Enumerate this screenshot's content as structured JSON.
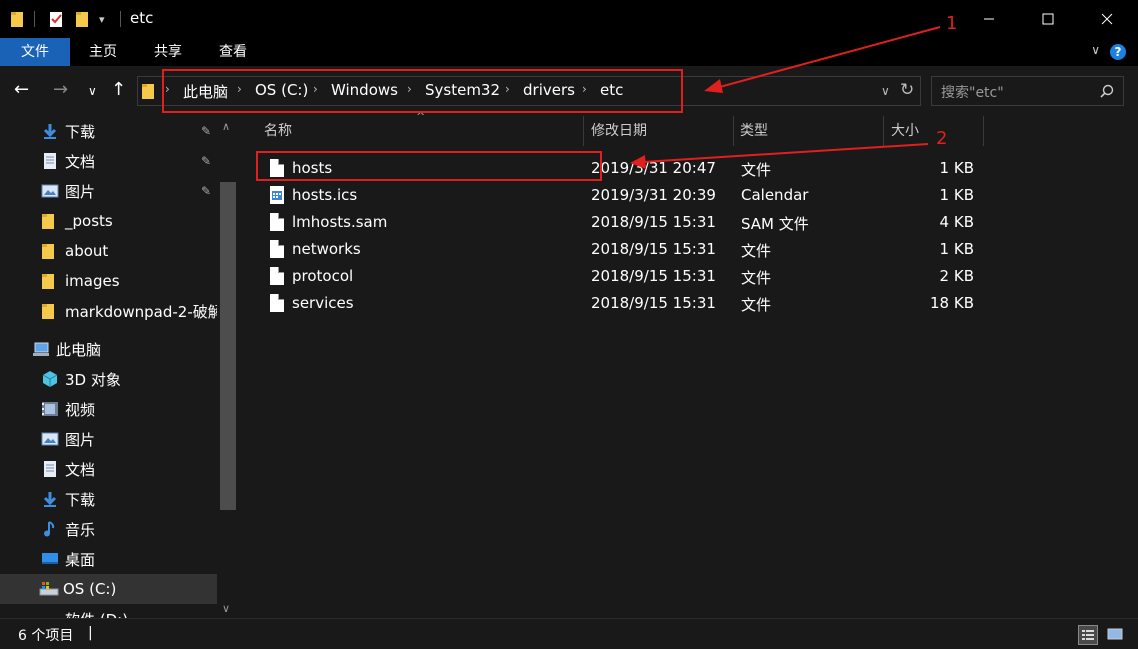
{
  "window": {
    "title": "etc",
    "minimize_icon": "minimize-icon",
    "maximize_icon": "maximize-icon",
    "close_icon": "close-icon"
  },
  "ribbon": {
    "tabs": [
      {
        "label": "文件",
        "active": true
      },
      {
        "label": "主页",
        "active": false
      },
      {
        "label": "共享",
        "active": false
      },
      {
        "label": "查看",
        "active": false
      }
    ],
    "help": "?"
  },
  "address": {
    "crumbs": [
      "此电脑",
      "OS (C:)",
      "Windows",
      "System32",
      "drivers",
      "etc"
    ]
  },
  "search": {
    "placeholder": "搜索\"etc\""
  },
  "sidebar": {
    "quick_access": [
      {
        "label": "下载",
        "icon": "download-icon",
        "pinned": true
      },
      {
        "label": "文档",
        "icon": "documents-icon",
        "pinned": true
      },
      {
        "label": "图片",
        "icon": "pictures-icon",
        "pinned": true
      },
      {
        "label": "_posts",
        "icon": "folder-icon",
        "pinned": false
      },
      {
        "label": "about",
        "icon": "folder-icon",
        "pinned": false
      },
      {
        "label": "images",
        "icon": "folder-icon",
        "pinned": false
      },
      {
        "label": "markdownpad-2-破解",
        "icon": "folder-icon",
        "pinned": false
      }
    ],
    "this_pc": {
      "label": "此电脑",
      "icon": "computer-icon"
    },
    "pc_items": [
      {
        "label": "3D 对象",
        "icon": "3d-objects-icon"
      },
      {
        "label": "视频",
        "icon": "videos-icon"
      },
      {
        "label": "图片",
        "icon": "pictures-icon"
      },
      {
        "label": "文档",
        "icon": "documents-icon"
      },
      {
        "label": "下载",
        "icon": "download-icon"
      },
      {
        "label": "音乐",
        "icon": "music-icon"
      },
      {
        "label": "桌面",
        "icon": "desktop-icon"
      },
      {
        "label": "OS (C:)",
        "icon": "drive-icon"
      },
      {
        "label": "软件 (D:)",
        "icon": "drive-icon"
      }
    ]
  },
  "columns": {
    "name": "名称",
    "date": "修改日期",
    "type": "类型",
    "size": "大小"
  },
  "files": [
    {
      "name": "hosts",
      "date": "2019/3/31 20:47",
      "type": "文件",
      "size": "1 KB",
      "icon": "file-icon"
    },
    {
      "name": "hosts.ics",
      "date": "2019/3/31 20:39",
      "type": "Calendar",
      "size": "1 KB",
      "icon": "calendar-file-icon"
    },
    {
      "name": "lmhosts.sam",
      "date": "2018/9/15 15:31",
      "type": "SAM 文件",
      "size": "4 KB",
      "icon": "file-icon"
    },
    {
      "name": "networks",
      "date": "2018/9/15 15:31",
      "type": "文件",
      "size": "1 KB",
      "icon": "file-icon"
    },
    {
      "name": "protocol",
      "date": "2018/9/15 15:31",
      "type": "文件",
      "size": "2 KB",
      "icon": "file-icon"
    },
    {
      "name": "services",
      "date": "2018/9/15 15:31",
      "type": "文件",
      "size": "18 KB",
      "icon": "file-icon"
    }
  ],
  "status": {
    "count": "6 个项目",
    "cursor": "|"
  },
  "annotations": {
    "label1": "1",
    "label2": "2",
    "color": "#e01f1f"
  },
  "colors": {
    "accent": "#1a62b6",
    "bg": "#191919",
    "titlebar": "#000000"
  }
}
